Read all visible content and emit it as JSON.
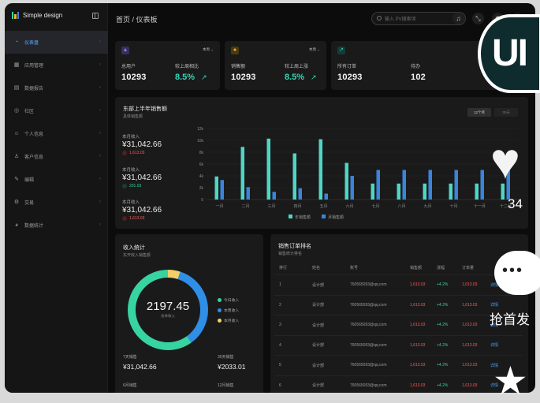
{
  "app": {
    "brand": "Simple design"
  },
  "sidebar": {
    "items": [
      {
        "label": "仪表盘",
        "icon": "gauge-icon",
        "glyph": "◔",
        "active": true
      },
      {
        "label": "应用管理",
        "icon": "apps-icon",
        "glyph": "▦"
      },
      {
        "label": "数据报告",
        "icon": "report-icon",
        "glyph": "▤"
      },
      {
        "label": "社区",
        "icon": "community-icon",
        "glyph": "◎"
      },
      {
        "label": "个人信息",
        "icon": "smile-icon",
        "glyph": "☺"
      },
      {
        "label": "客户信息",
        "icon": "user-icon",
        "glyph": "♙"
      },
      {
        "label": "编辑",
        "icon": "edit-icon",
        "glyph": "✎"
      },
      {
        "label": "交易",
        "icon": "transaction-icon",
        "glyph": "⚙"
      },
      {
        "label": "数据统计",
        "icon": "pie-icon",
        "glyph": "◕"
      }
    ]
  },
  "header": {
    "breadcrumb": "首页 / 仪表板",
    "search_placeholder": "输入 PV搜索项"
  },
  "stats": [
    {
      "selector": "本周",
      "label1": "总用户",
      "value1": "10293",
      "label2": "较上周相比",
      "value2": "8.5%",
      "icon_color": "#6a5bd8"
    },
    {
      "selector": "本周",
      "label1": "销售额",
      "value1": "10293",
      "label2": "较上周上涨",
      "value2": "8.5%",
      "icon_color": "#f0b429"
    },
    {
      "label1": "所有订单",
      "value1": "10293",
      "label2": "待办",
      "value2": "102",
      "icon_color": "#37d3b4"
    }
  ],
  "sales_chart": {
    "title": "东部上半年销售额",
    "subtitle": "具体销售额",
    "toggle": [
      "12个月",
      "30天"
    ],
    "summaries": [
      {
        "label": "本月收入",
        "value": "¥31,042.66",
        "delta": "1,613.03",
        "color": "#ff5b5b"
      },
      {
        "label": "本月收入",
        "value": "¥31,042.66",
        "delta": "201.03",
        "color": "#38d6a0"
      },
      {
        "label": "本月收入",
        "value": "¥31,042.66",
        "delta": "1,613.03",
        "color": "#ff5b5b"
      }
    ]
  },
  "chart_data": {
    "type": "bar",
    "categories": [
      "一月",
      "二月",
      "三月",
      "四月",
      "五月",
      "六月",
      "七月",
      "八月",
      "九月",
      "十月",
      "十一月",
      "十二月"
    ],
    "series": [
      {
        "name": "年销售额",
        "color": "#4fd6c4",
        "values": [
          3.9,
          8.9,
          10.3,
          7.8,
          10.2,
          6.2,
          2.7,
          2.7,
          2.7,
          2.7,
          2.7,
          2.7
        ]
      },
      {
        "name": "月销售额",
        "color": "#3c84d8",
        "values": [
          3.3,
          2.1,
          1.3,
          1.9,
          1.0,
          4.0,
          5.0,
          5.0,
          5.0,
          5.0,
          5.0,
          5.0
        ]
      }
    ],
    "yticks": [
      "0",
      "2k",
      "4k",
      "6k",
      "8k",
      "10k",
      "12k"
    ],
    "ylim": [
      0,
      12
    ],
    "legend_position": "bottom"
  },
  "income": {
    "title": "收入统计",
    "subtitle": "东开收入销售额",
    "total": "2197.45",
    "total_caption": "总体收入",
    "legend": [
      {
        "label": "今日收入",
        "color": "#37d3a0"
      },
      {
        "label": "本周收入",
        "color": "#2f8ee6"
      },
      {
        "label": "本月收入",
        "color": "#f3cf6b"
      }
    ],
    "shares": [
      0.6,
      0.35,
      0.05
    ],
    "footer": [
      {
        "label": "7天销售",
        "value": "¥31,042.66"
      },
      {
        "label": "30天销售",
        "value": "¥2033.01"
      },
      {
        "label": "6月销售",
        "value": ""
      },
      {
        "label": "12月销售",
        "value": ""
      }
    ]
  },
  "ranking": {
    "title": "销售订单排名",
    "subtitle": "销售统计排名",
    "columns": [
      "排行",
      "姓名",
      "账号",
      "销售额",
      "涨幅",
      "订单量",
      ""
    ],
    "rows": [
      [
        "1",
        "设计部",
        "760565093@qq.com",
        "1,613.03",
        "+4.2%",
        "1,613.03",
        "详情"
      ],
      [
        "2",
        "设计部",
        "760565093@qq.com",
        "1,613.03",
        "+4.2%",
        "1,613.03",
        "详情"
      ],
      [
        "3",
        "设计部",
        "760565093@qq.com",
        "1,613.03",
        "+4.2%",
        "1,613.03",
        "详情"
      ],
      [
        "4",
        "设计部",
        "760565093@qq.com",
        "1,613.03",
        "+4.2%",
        "1,613.03",
        "详情"
      ],
      [
        "5",
        "设计部",
        "760565093@qq.com",
        "1,613.03",
        "+4.2%",
        "1,613.03",
        "详情"
      ],
      [
        "6",
        "设计部",
        "760565093@qq.com",
        "1,613.03",
        "+4.2%",
        "1,613.03",
        "详情"
      ]
    ]
  },
  "overlay": {
    "logo_text": "UI",
    "like_count": "34",
    "cta_text": "抢首发"
  }
}
